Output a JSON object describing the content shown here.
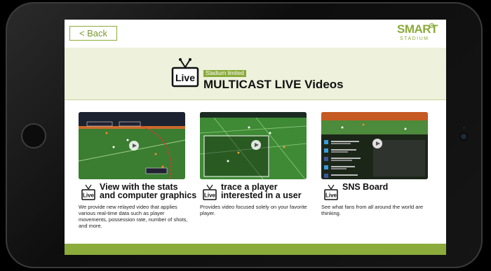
{
  "header": {
    "back_label": "< Back",
    "logo_main": "SMART",
    "logo_sub": "STADIUM"
  },
  "banner": {
    "badge": "Stadium limited",
    "title": "MULTICAST LIVE Videos",
    "icon_text": "Live"
  },
  "cards": [
    {
      "title_line1": "View with the stats",
      "title_line2": "and computer graphics",
      "desc": "We provide new relayed video that applies various real-time data such as player movements, possession rate, number of shots, and more.",
      "icon_text": "Live"
    },
    {
      "title_line1": "trace a player",
      "title_line2": "interested in a user",
      "desc": "Provides video focused solely on your favorite player.",
      "icon_text": "Live"
    },
    {
      "title_line1": "SNS Board",
      "title_line2": "",
      "desc": "See what fans from all around the world are thinking.",
      "icon_text": "Live"
    }
  ],
  "colors": {
    "accent": "#8bab3a",
    "banner_bg": "#eef2dc",
    "bezel": "#151515"
  }
}
